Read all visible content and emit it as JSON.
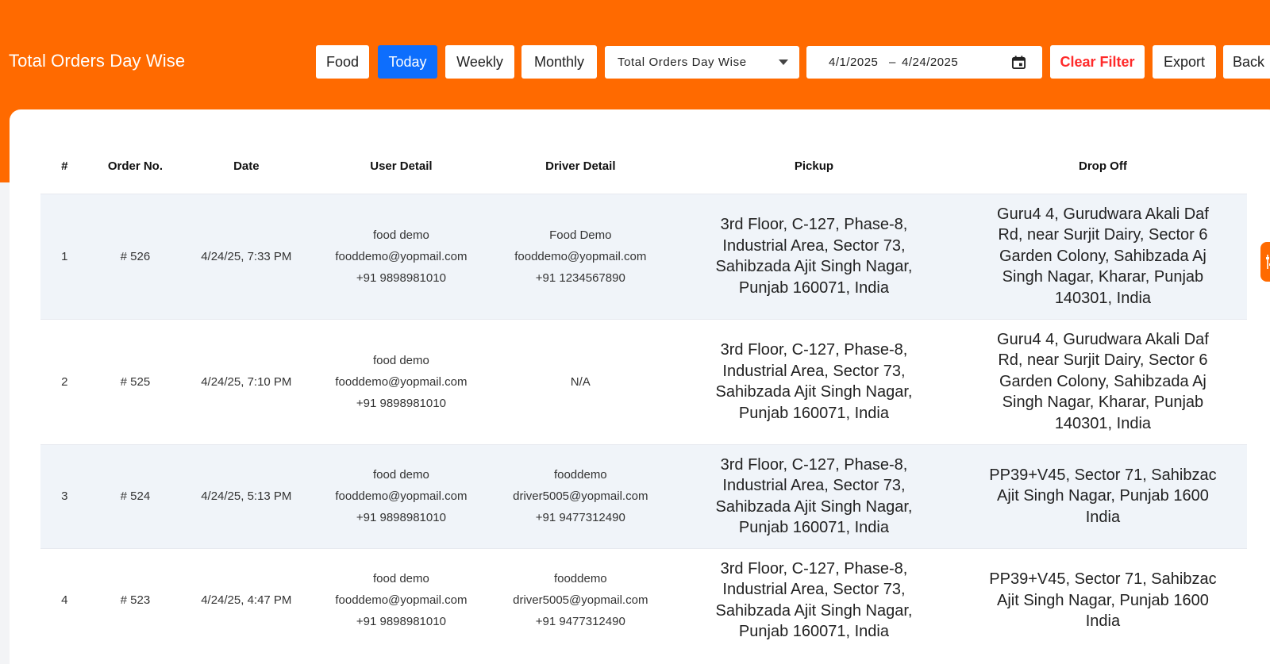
{
  "header": {
    "title": "Total Orders Day Wise"
  },
  "toolbar": {
    "buttons": {
      "food": "Food",
      "today": "Today",
      "weekly": "Weekly",
      "monthly": "Monthly",
      "clear_filter": "Clear Filter",
      "export": "Export",
      "back": "Back"
    },
    "active_button": "Today",
    "report_select": {
      "value": "Total Orders Day Wise"
    },
    "date_range": {
      "start": "4/1/2025",
      "separator": "–",
      "end": "4/24/2025"
    }
  },
  "table": {
    "columns": [
      "#",
      "Order No.",
      "Date",
      "User Detail",
      "Driver Detail",
      "Pickup",
      "Drop Off"
    ],
    "rows": [
      {
        "index": "1",
        "order_no": "# 526",
        "date": "4/24/25, 7:33 PM",
        "user": {
          "name": "food demo",
          "email": "fooddemo@yopmail.com",
          "phone": "+91 9898981010"
        },
        "driver": {
          "name": "Food Demo",
          "email": "fooddemo@yopmail.com",
          "phone": "+91 1234567890"
        },
        "pickup": [
          "3rd Floor, C-127, Phase-8,",
          "Industrial Area, Sector 73,",
          "Sahibzada Ajit Singh Nagar,",
          "Punjab 160071, India"
        ],
        "dropoff": [
          "Guru4 4, Gurudwara Akali Daf",
          "Rd, near Surjit Dairy, Sector 6",
          "Garden Colony, Sahibzada Aj",
          "Singh Nagar, Kharar, Punjab",
          "140301, India"
        ]
      },
      {
        "index": "2",
        "order_no": "# 525",
        "date": "4/24/25, 7:10 PM",
        "user": {
          "name": "food demo",
          "email": "fooddemo@yopmail.com",
          "phone": "+91 9898981010"
        },
        "driver": {
          "na": "N/A"
        },
        "pickup": [
          "3rd Floor, C-127, Phase-8,",
          "Industrial Area, Sector 73,",
          "Sahibzada Ajit Singh Nagar,",
          "Punjab 160071, India"
        ],
        "dropoff": [
          "Guru4 4, Gurudwara Akali Daf",
          "Rd, near Surjit Dairy, Sector 6",
          "Garden Colony, Sahibzada Aj",
          "Singh Nagar, Kharar, Punjab",
          "140301, India"
        ]
      },
      {
        "index": "3",
        "order_no": "# 524",
        "date": "4/24/25, 5:13 PM",
        "user": {
          "name": "food demo",
          "email": "fooddemo@yopmail.com",
          "phone": "+91 9898981010"
        },
        "driver": {
          "name": "fooddemo",
          "email": "driver5005@yopmail.com",
          "phone": "+91 9477312490"
        },
        "pickup": [
          "3rd Floor, C-127, Phase-8,",
          "Industrial Area, Sector 73,",
          "Sahibzada Ajit Singh Nagar,",
          "Punjab 160071, India"
        ],
        "dropoff": [
          "PP39+V45, Sector 71, Sahibzac",
          "Ajit Singh Nagar, Punjab 1600",
          "India"
        ]
      },
      {
        "index": "4",
        "order_no": "# 523",
        "date": "4/24/25, 4:47 PM",
        "user": {
          "name": "food demo",
          "email": "fooddemo@yopmail.com",
          "phone": "+91 9898981010"
        },
        "driver": {
          "name": "fooddemo",
          "email": "driver5005@yopmail.com",
          "phone": "+91 9477312490"
        },
        "pickup": [
          "3rd Floor, C-127, Phase-8,",
          "Industrial Area, Sector 73,",
          "Sahibzada Ajit Singh Nagar,",
          "Punjab 160071, India"
        ],
        "dropoff": [
          "PP39+V45, Sector 71, Sahibzac",
          "Ajit Singh Nagar, Punjab 1600",
          "India"
        ]
      }
    ]
  },
  "side_tab": {
    "icon": "sliders-icon"
  },
  "colors": {
    "brand": "#ff6a00",
    "active_button": "#0d6efd",
    "clear_filter_text": "#ff2a2a",
    "row_alt": "#f0f4f9"
  }
}
